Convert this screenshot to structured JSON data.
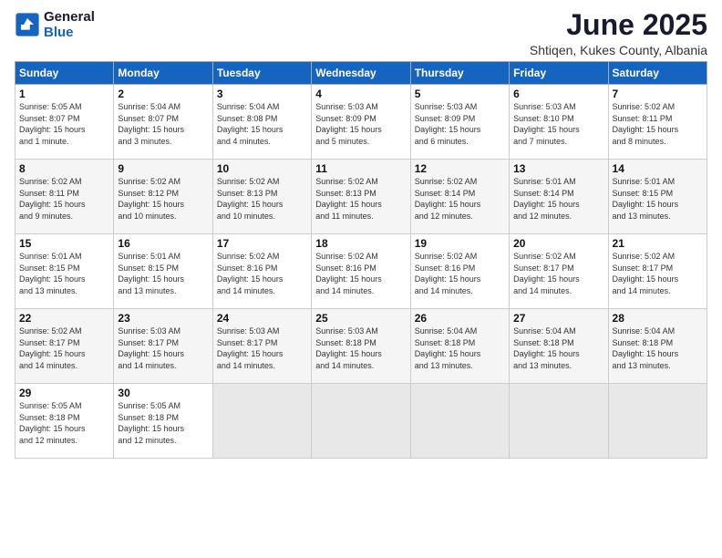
{
  "logo": {
    "general": "General",
    "blue": "Blue"
  },
  "title": "June 2025",
  "location": "Shtiqen, Kukes County, Albania",
  "headers": [
    "Sunday",
    "Monday",
    "Tuesday",
    "Wednesday",
    "Thursday",
    "Friday",
    "Saturday"
  ],
  "weeks": [
    [
      {
        "day": "1",
        "info": "Sunrise: 5:05 AM\nSunset: 8:07 PM\nDaylight: 15 hours\nand 1 minute."
      },
      {
        "day": "2",
        "info": "Sunrise: 5:04 AM\nSunset: 8:07 PM\nDaylight: 15 hours\nand 3 minutes."
      },
      {
        "day": "3",
        "info": "Sunrise: 5:04 AM\nSunset: 8:08 PM\nDaylight: 15 hours\nand 4 minutes."
      },
      {
        "day": "4",
        "info": "Sunrise: 5:03 AM\nSunset: 8:09 PM\nDaylight: 15 hours\nand 5 minutes."
      },
      {
        "day": "5",
        "info": "Sunrise: 5:03 AM\nSunset: 8:09 PM\nDaylight: 15 hours\nand 6 minutes."
      },
      {
        "day": "6",
        "info": "Sunrise: 5:03 AM\nSunset: 8:10 PM\nDaylight: 15 hours\nand 7 minutes."
      },
      {
        "day": "7",
        "info": "Sunrise: 5:02 AM\nSunset: 8:11 PM\nDaylight: 15 hours\nand 8 minutes."
      }
    ],
    [
      {
        "day": "8",
        "info": "Sunrise: 5:02 AM\nSunset: 8:11 PM\nDaylight: 15 hours\nand 9 minutes."
      },
      {
        "day": "9",
        "info": "Sunrise: 5:02 AM\nSunset: 8:12 PM\nDaylight: 15 hours\nand 10 minutes."
      },
      {
        "day": "10",
        "info": "Sunrise: 5:02 AM\nSunset: 8:13 PM\nDaylight: 15 hours\nand 10 minutes."
      },
      {
        "day": "11",
        "info": "Sunrise: 5:02 AM\nSunset: 8:13 PM\nDaylight: 15 hours\nand 11 minutes."
      },
      {
        "day": "12",
        "info": "Sunrise: 5:02 AM\nSunset: 8:14 PM\nDaylight: 15 hours\nand 12 minutes."
      },
      {
        "day": "13",
        "info": "Sunrise: 5:01 AM\nSunset: 8:14 PM\nDaylight: 15 hours\nand 12 minutes."
      },
      {
        "day": "14",
        "info": "Sunrise: 5:01 AM\nSunset: 8:15 PM\nDaylight: 15 hours\nand 13 minutes."
      }
    ],
    [
      {
        "day": "15",
        "info": "Sunrise: 5:01 AM\nSunset: 8:15 PM\nDaylight: 15 hours\nand 13 minutes."
      },
      {
        "day": "16",
        "info": "Sunrise: 5:01 AM\nSunset: 8:15 PM\nDaylight: 15 hours\nand 13 minutes."
      },
      {
        "day": "17",
        "info": "Sunrise: 5:02 AM\nSunset: 8:16 PM\nDaylight: 15 hours\nand 14 minutes."
      },
      {
        "day": "18",
        "info": "Sunrise: 5:02 AM\nSunset: 8:16 PM\nDaylight: 15 hours\nand 14 minutes."
      },
      {
        "day": "19",
        "info": "Sunrise: 5:02 AM\nSunset: 8:16 PM\nDaylight: 15 hours\nand 14 minutes."
      },
      {
        "day": "20",
        "info": "Sunrise: 5:02 AM\nSunset: 8:17 PM\nDaylight: 15 hours\nand 14 minutes."
      },
      {
        "day": "21",
        "info": "Sunrise: 5:02 AM\nSunset: 8:17 PM\nDaylight: 15 hours\nand 14 minutes."
      }
    ],
    [
      {
        "day": "22",
        "info": "Sunrise: 5:02 AM\nSunset: 8:17 PM\nDaylight: 15 hours\nand 14 minutes."
      },
      {
        "day": "23",
        "info": "Sunrise: 5:03 AM\nSunset: 8:17 PM\nDaylight: 15 hours\nand 14 minutes."
      },
      {
        "day": "24",
        "info": "Sunrise: 5:03 AM\nSunset: 8:17 PM\nDaylight: 15 hours\nand 14 minutes."
      },
      {
        "day": "25",
        "info": "Sunrise: 5:03 AM\nSunset: 8:18 PM\nDaylight: 15 hours\nand 14 minutes."
      },
      {
        "day": "26",
        "info": "Sunrise: 5:04 AM\nSunset: 8:18 PM\nDaylight: 15 hours\nand 13 minutes."
      },
      {
        "day": "27",
        "info": "Sunrise: 5:04 AM\nSunset: 8:18 PM\nDaylight: 15 hours\nand 13 minutes."
      },
      {
        "day": "28",
        "info": "Sunrise: 5:04 AM\nSunset: 8:18 PM\nDaylight: 15 hours\nand 13 minutes."
      }
    ],
    [
      {
        "day": "29",
        "info": "Sunrise: 5:05 AM\nSunset: 8:18 PM\nDaylight: 15 hours\nand 12 minutes."
      },
      {
        "day": "30",
        "info": "Sunrise: 5:05 AM\nSunset: 8:18 PM\nDaylight: 15 hours\nand 12 minutes."
      },
      {
        "day": "",
        "info": ""
      },
      {
        "day": "",
        "info": ""
      },
      {
        "day": "",
        "info": ""
      },
      {
        "day": "",
        "info": ""
      },
      {
        "day": "",
        "info": ""
      }
    ]
  ]
}
